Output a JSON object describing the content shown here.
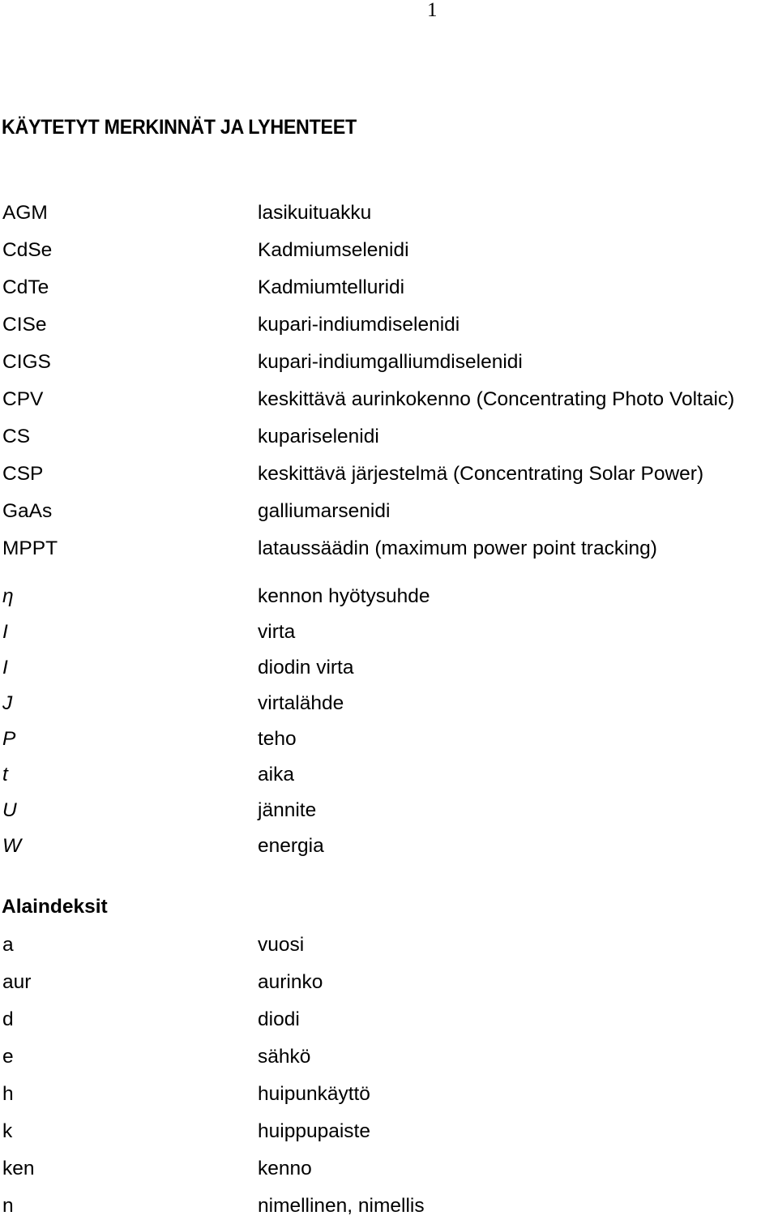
{
  "page_number": "1",
  "heading": "KÄYTETYT MERKINNÄT JA LYHENTEET",
  "abbreviations": [
    {
      "term": "AGM",
      "definition": "lasikuituakku"
    },
    {
      "term": "CdSe",
      "definition": "Kadmiumselenidi"
    },
    {
      "term": "CdTe",
      "definition": "Kadmiumtelluridi"
    },
    {
      "term": "CISe",
      "definition": "kupari-indiumdiselenidi"
    },
    {
      "term": "CIGS",
      "definition": "kupari-indiumgalliumdiselenidi"
    },
    {
      "term": "CPV",
      "definition": "keskittävä aurinkokenno (Concentrating Photo Voltaic)"
    },
    {
      "term": "CS",
      "definition": "kupariselenidi"
    },
    {
      "term": "CSP",
      "definition": "keskittävä järjestelmä (Concentrating Solar Power)"
    },
    {
      "term": "GaAs",
      "definition": "galliumarsenidi"
    },
    {
      "term": "MPPT",
      "definition": "lataussäädin (maximum power point tracking)"
    }
  ],
  "symbols": [
    {
      "term": "η",
      "definition": "kennon hyötysuhde"
    },
    {
      "term": "I",
      "definition": "virta"
    },
    {
      "term": "I",
      "definition": "diodin virta"
    },
    {
      "term": "J",
      "definition": "virtalähde"
    },
    {
      "term": "P",
      "definition": "teho"
    },
    {
      "term": "t",
      "definition": "aika"
    },
    {
      "term": "U",
      "definition": "jännite"
    },
    {
      "term": "W",
      "definition": "energia"
    }
  ],
  "subscripts_heading": "Alaindeksit",
  "subscripts": [
    {
      "term": "a",
      "definition": "vuosi"
    },
    {
      "term": "aur",
      "definition": "aurinko"
    },
    {
      "term": "d",
      "definition": "diodi"
    },
    {
      "term": "e",
      "definition": "sähkö"
    },
    {
      "term": "h",
      "definition": "huipunkäyttö"
    },
    {
      "term": "k",
      "definition": "huippupaiste"
    },
    {
      "term": "ken",
      "definition": "kenno"
    },
    {
      "term": "n",
      "definition": "nimellinen, nimellis"
    }
  ]
}
